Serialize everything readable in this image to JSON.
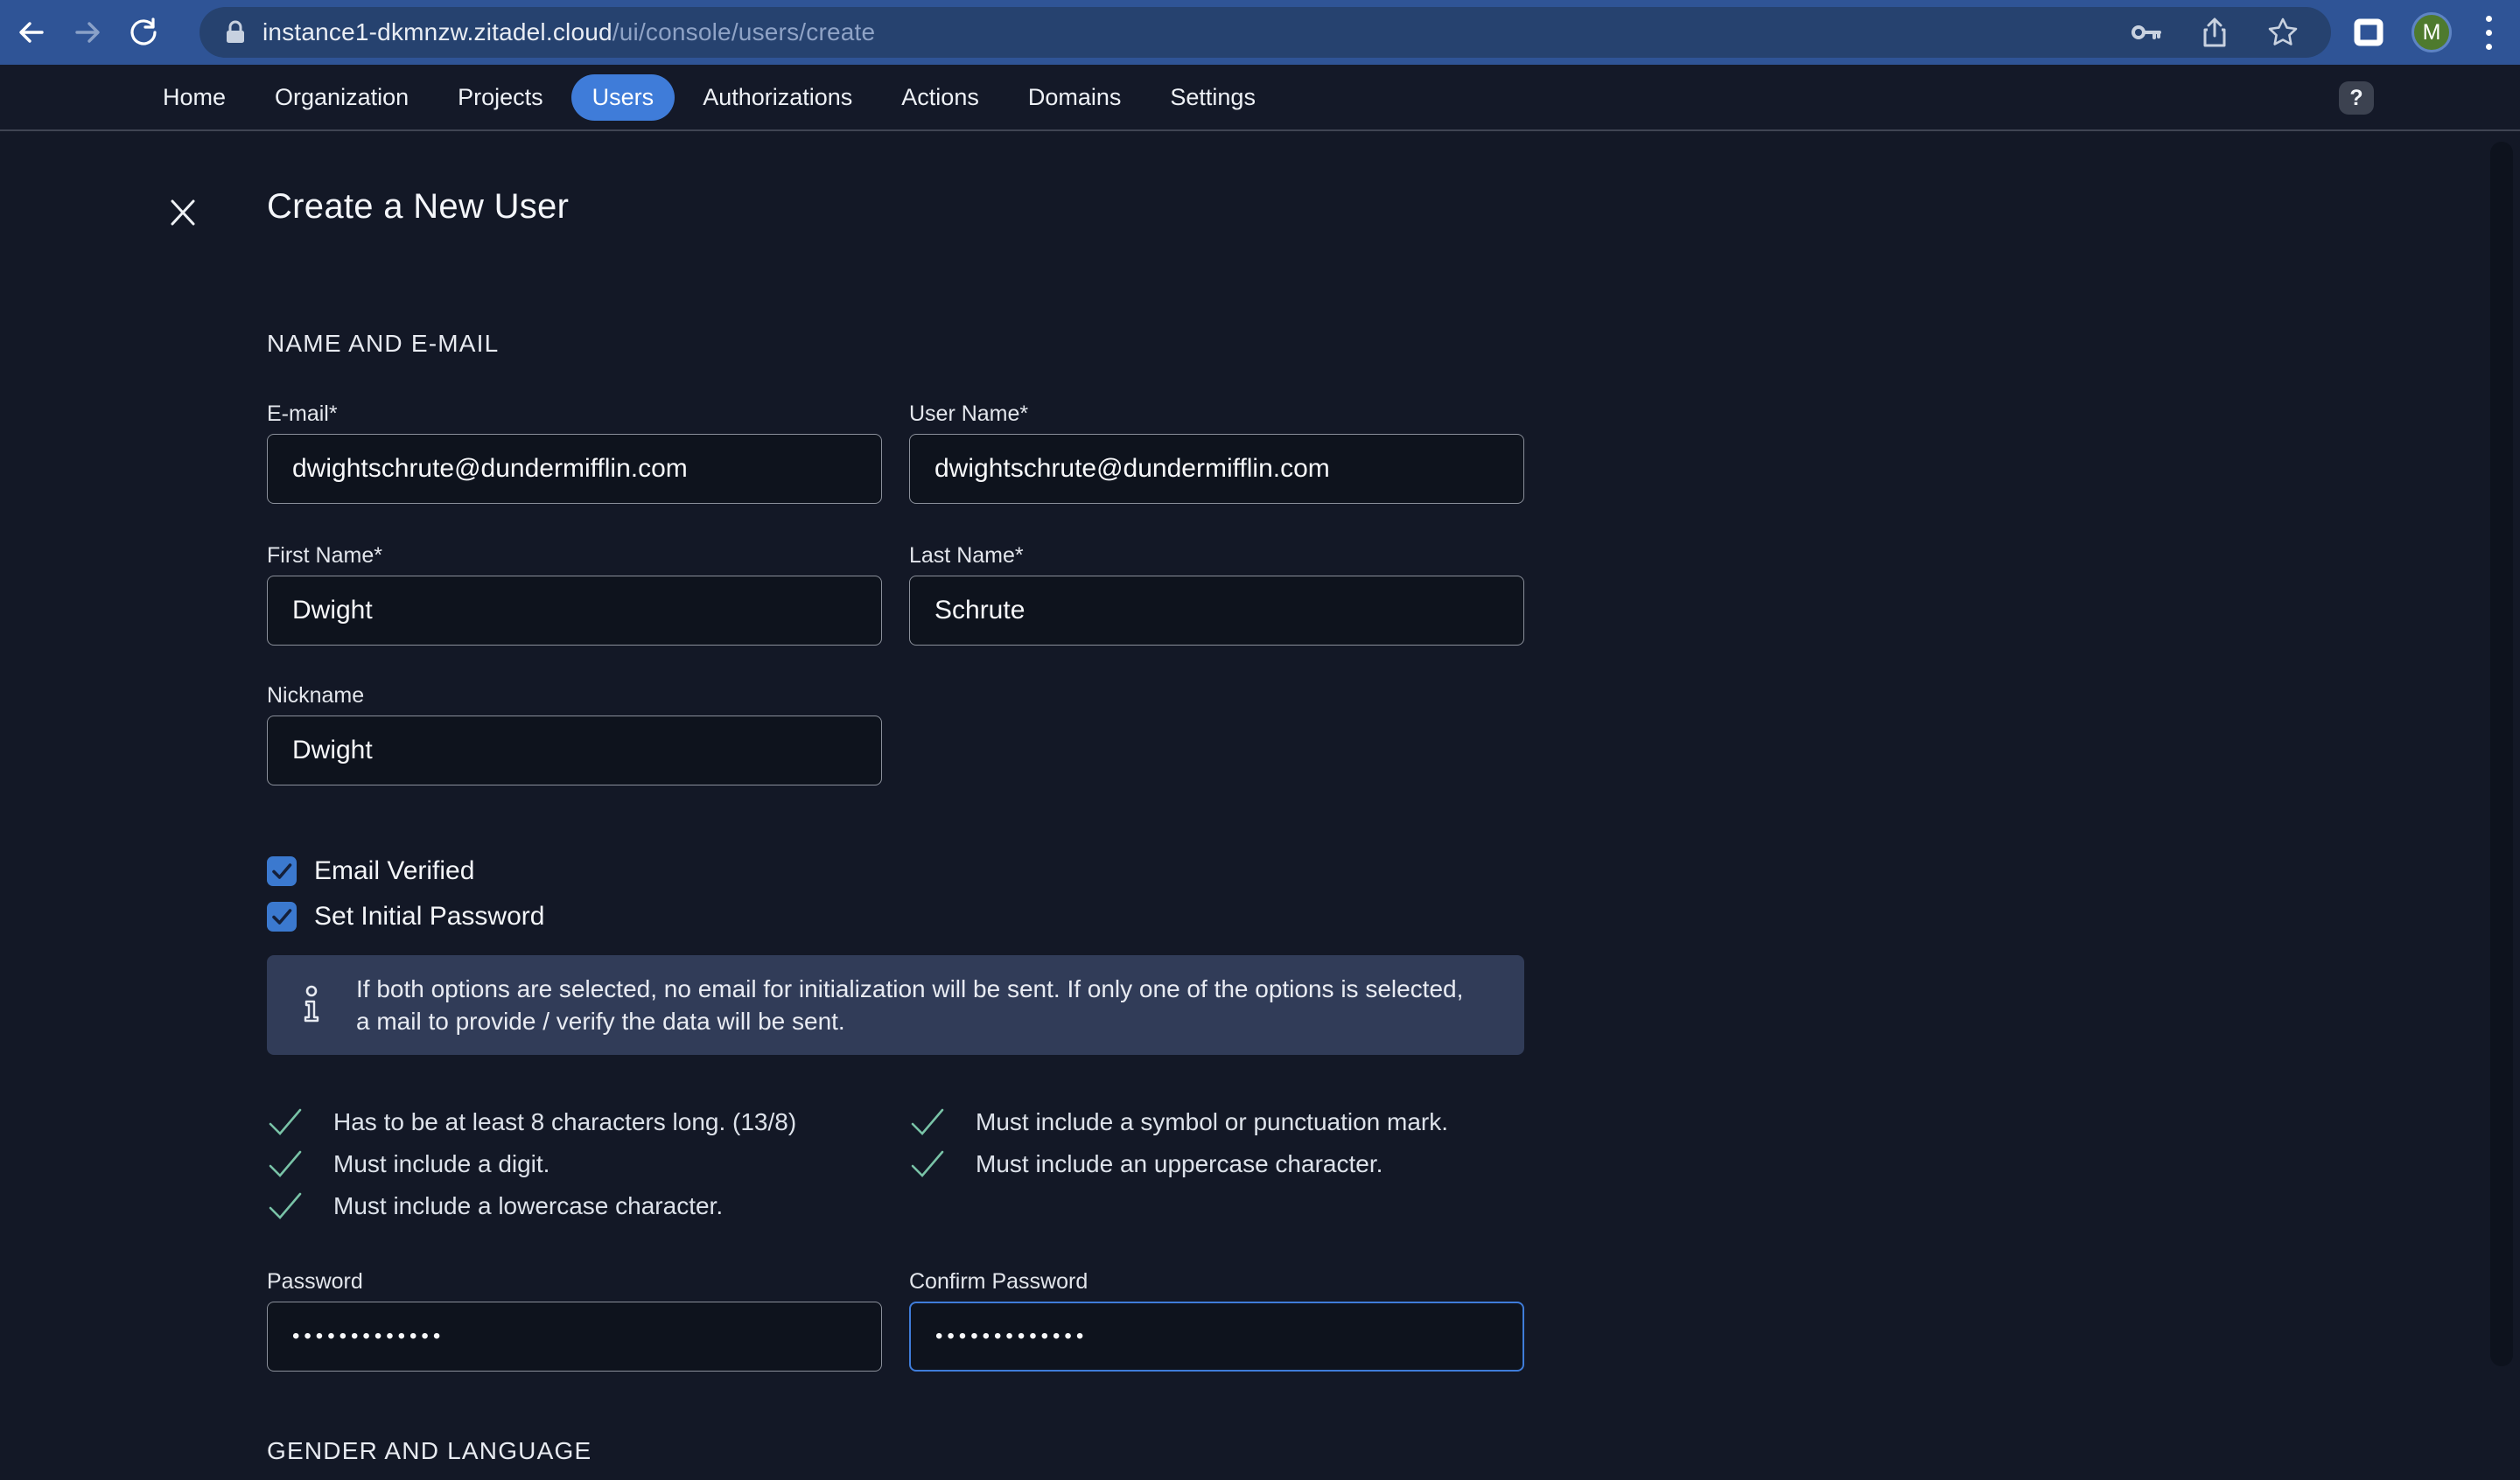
{
  "browser": {
    "url_domain": "instance1-dkmnzw.zitadel.cloud",
    "url_path": "/ui/console/users/create",
    "avatar_initial": "M"
  },
  "nav": {
    "tabs": [
      {
        "label": "Home"
      },
      {
        "label": "Organization"
      },
      {
        "label": "Projects"
      },
      {
        "label": "Users"
      },
      {
        "label": "Authorizations"
      },
      {
        "label": "Actions"
      },
      {
        "label": "Domains"
      },
      {
        "label": "Settings"
      }
    ],
    "active_tab": "Users",
    "help_label": "?"
  },
  "page": {
    "title": "Create a New User",
    "section_name_email": "NAME AND E-MAIL",
    "section_gender_language": "GENDER AND LANGUAGE",
    "fields": {
      "email": {
        "label": "E-mail*",
        "value": "dwightschrute@dundermifflin.com"
      },
      "username": {
        "label": "User Name*",
        "value": "dwightschrute@dundermifflin.com"
      },
      "first_name": {
        "label": "First Name*",
        "value": "Dwight"
      },
      "last_name": {
        "label": "Last Name*",
        "value": "Schrute"
      },
      "nickname": {
        "label": "Nickname",
        "value": "Dwight"
      },
      "password": {
        "label": "Password",
        "value": "•••••••••••••"
      },
      "confirm_password": {
        "label": "Confirm Password",
        "value": "•••••••••••••"
      }
    },
    "checkboxes": [
      {
        "label": "Email Verified",
        "checked": true
      },
      {
        "label": "Set Initial Password",
        "checked": true
      }
    ],
    "info_note": "If both options are selected, no email for initialization will be sent. If only one of the options is selected, a mail to provide / verify the data will be sent.",
    "password_requirements": {
      "left": [
        "Has to be at least 8 characters long. (13/8)",
        "Must include a digit.",
        "Must include a lowercase character."
      ],
      "right": [
        "Must include a symbol or punctuation mark.",
        "Must include an uppercase character."
      ]
    }
  },
  "colors": {
    "toolbar": "#2f5496",
    "omnibox": "#26426f",
    "app_background": "#131826",
    "accent_blue": "#3f7cd9",
    "checkbox_blue": "#3b79cf",
    "info_box": "#313c58",
    "success_check": "#79c3a7",
    "avatar_green": "#4e7a2e"
  }
}
